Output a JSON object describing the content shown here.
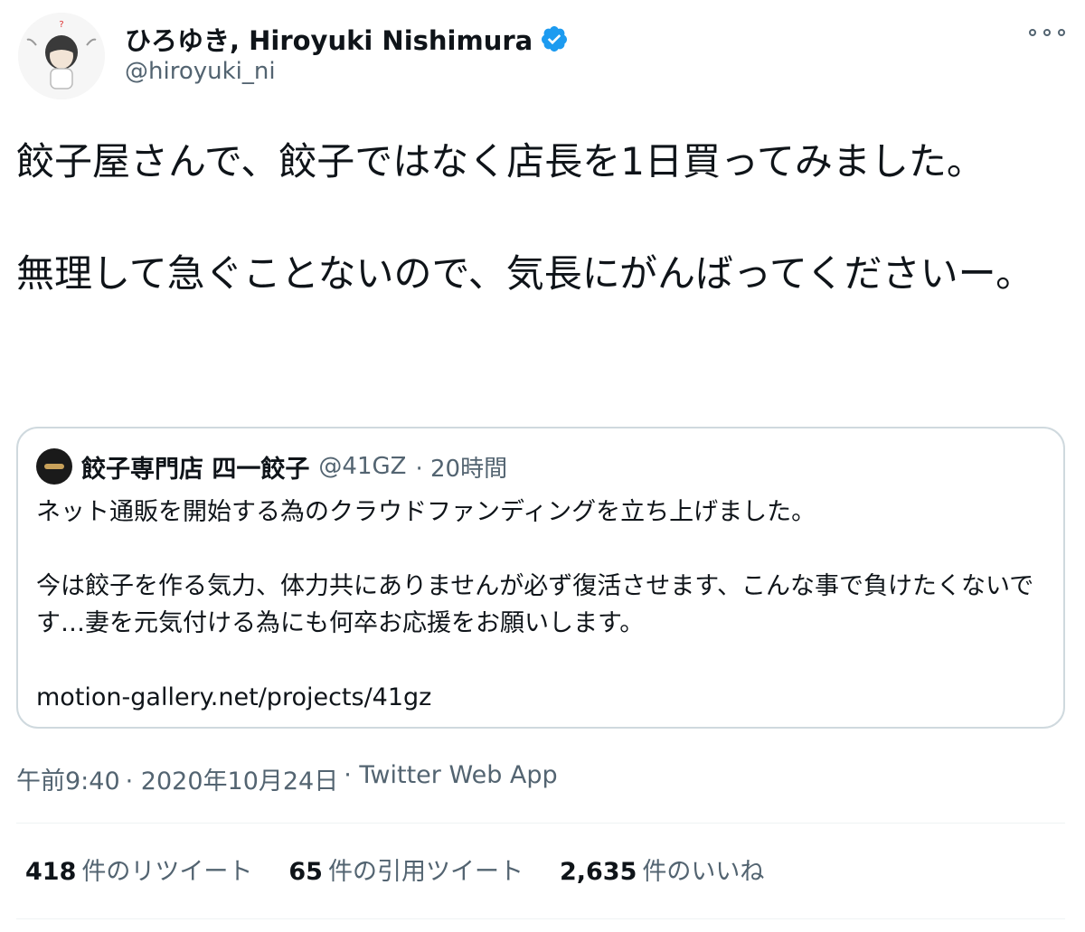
{
  "author": {
    "display_name": "ひろゆき, Hiroyuki Nishimura",
    "handle": "@hiroyuki_ni",
    "verified": true
  },
  "tweet": {
    "text": "餃子屋さんで、餃子ではなく店長を1日買ってみました。\n\n無理して急ぐことないので、気長にがんばってくださいー。"
  },
  "quoted_tweet": {
    "display_name": "餃子専門店 四一餃子",
    "handle": "@41GZ",
    "time": "· 20時間",
    "text": "ネット通販を開始する為のクラウドファンディングを立ち上げました。\n\n今は餃子を作る気力、体力共にありませんが必ず復活させます、こんな事で負けたくないです…妻を元気付ける為にも何卒お応援をお願いします。\n\nmotion-gallery.net/projects/41gz"
  },
  "meta": {
    "time": "午前9:40",
    "date": "· 2020年10月24日",
    "source": "· Twitter Web App"
  },
  "stats": {
    "retweets_count": "418",
    "retweets_label": "件のリツイート",
    "quotes_count": "65",
    "quotes_label": "件の引用ツイート",
    "likes_count": "2,635",
    "likes_label": "件のいいね"
  },
  "colors": {
    "text": "#0f1419",
    "secondary": "#536471",
    "verified_blue": "#1d9bf0",
    "border": "#cfd9de"
  },
  "icons": [
    "verified-badge-icon",
    "more-options-icon"
  ]
}
